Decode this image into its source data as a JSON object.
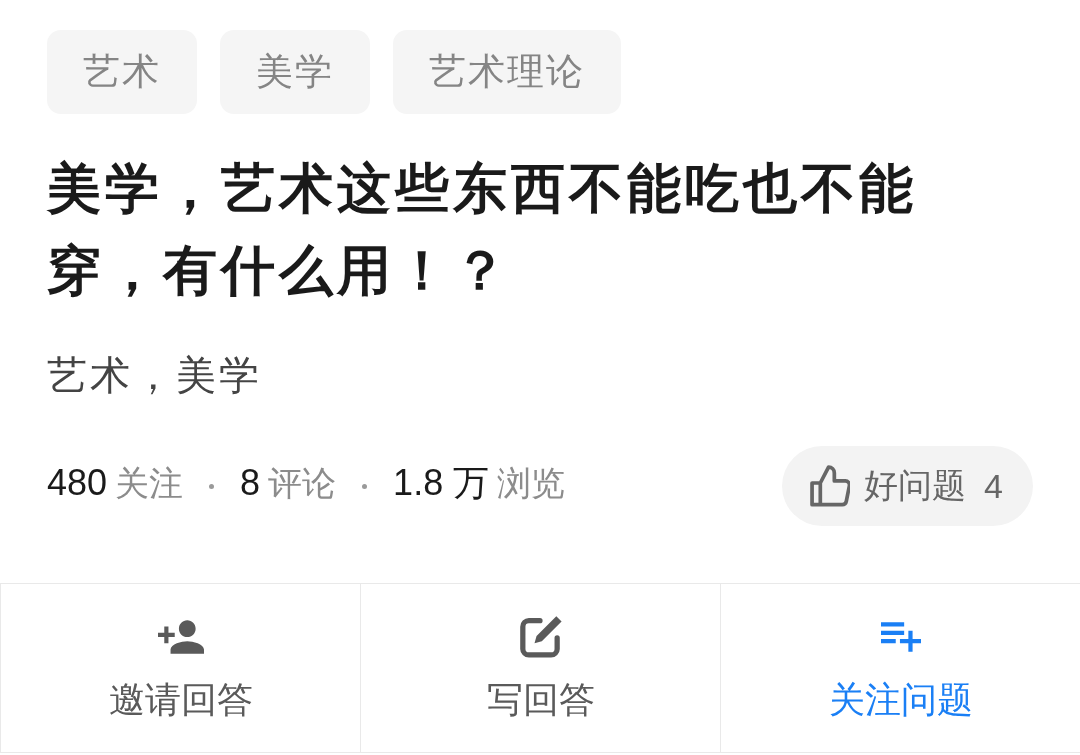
{
  "tags": [
    "艺术",
    "美学",
    "艺术理论"
  ],
  "question": {
    "title": "美学，艺术这些东西不能吃也不能穿，有什么用！？",
    "description": "艺术，美学"
  },
  "stats": [
    {
      "figure": "480",
      "metric": "关注"
    },
    {
      "figure": "8",
      "metric": "评论"
    },
    {
      "figure": "1.8 万",
      "metric": "浏览"
    }
  ],
  "good_question_button": {
    "label": "好问题",
    "count": "4"
  },
  "actions": [
    {
      "kind": "invite",
      "label": "邀请回答",
      "highlighted": false
    },
    {
      "kind": "write",
      "label": "写回答",
      "highlighted": false
    },
    {
      "kind": "follow",
      "label": "关注问题",
      "highlighted": true
    }
  ]
}
